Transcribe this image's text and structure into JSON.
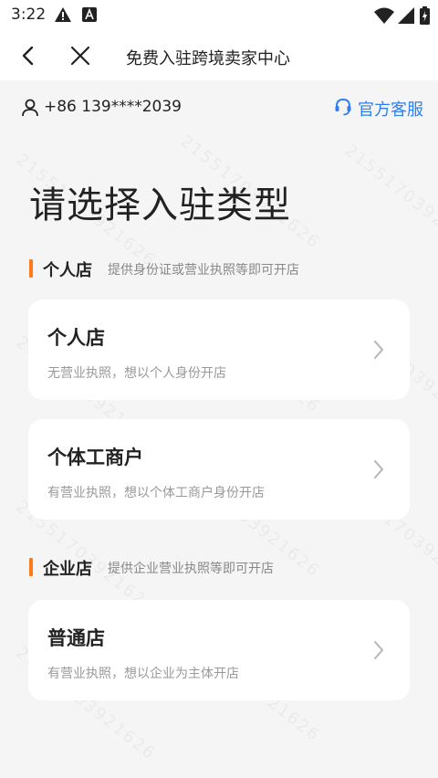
{
  "status_bar": {
    "time": "3:22"
  },
  "nav": {
    "title": "免费入驻跨境卖家中心"
  },
  "account": {
    "phone": "+86 139****2039",
    "support_label": "官方客服"
  },
  "page_title": "请选择入驻类型",
  "sections": [
    {
      "title": "个人店",
      "subtitle": "提供身份证或营业执照等即可开店",
      "cards": [
        {
          "title": "个人店",
          "desc": "无营业执照，想以个人身份开店"
        },
        {
          "title": "个体工商户",
          "desc": "有营业执照，想以个体工商户身份开店"
        }
      ]
    },
    {
      "title": "企业店",
      "subtitle": "提供企业营业执照等即可开店",
      "cards": [
        {
          "title": "普通店",
          "desc": "有营业执照，想以企业为主体开店"
        }
      ]
    }
  ],
  "watermark": "21551703921626",
  "colors": {
    "accent": "#ff7a1a",
    "link": "#2f7ff0",
    "background": "#f5f5f5"
  }
}
